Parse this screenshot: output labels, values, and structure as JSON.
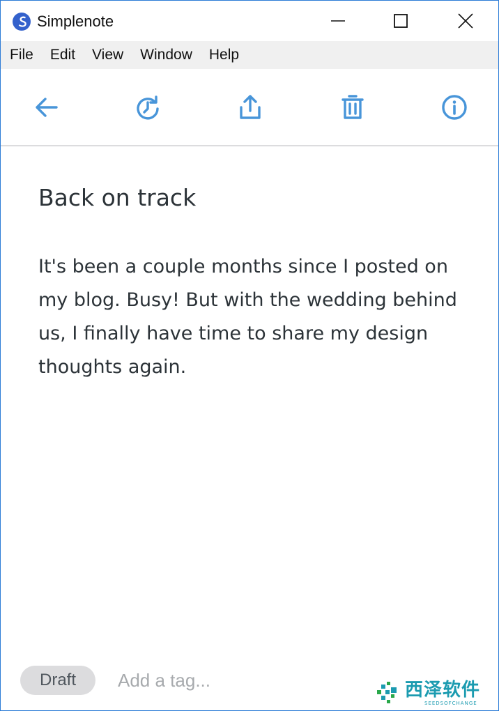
{
  "window": {
    "title": "Simplenote",
    "controls": [
      "minimize",
      "maximize",
      "close"
    ]
  },
  "menu": {
    "items": [
      "File",
      "Edit",
      "View",
      "Window",
      "Help"
    ]
  },
  "toolbar": {
    "icons": [
      "back-arrow-icon",
      "history-icon",
      "share-icon",
      "trash-icon",
      "info-icon"
    ],
    "accent_color": "#4895d9"
  },
  "note": {
    "title": "Back on track",
    "body": "It's been a couple months since I posted on my blog. Busy! But with the wedding behind us, I finally have time to share my design thoughts again."
  },
  "tags": {
    "items": [
      "Draft"
    ],
    "input_placeholder": "Add a tag..."
  },
  "watermark": {
    "text": "西泽软件",
    "subtext": "SEEDSOFCHANGE"
  }
}
